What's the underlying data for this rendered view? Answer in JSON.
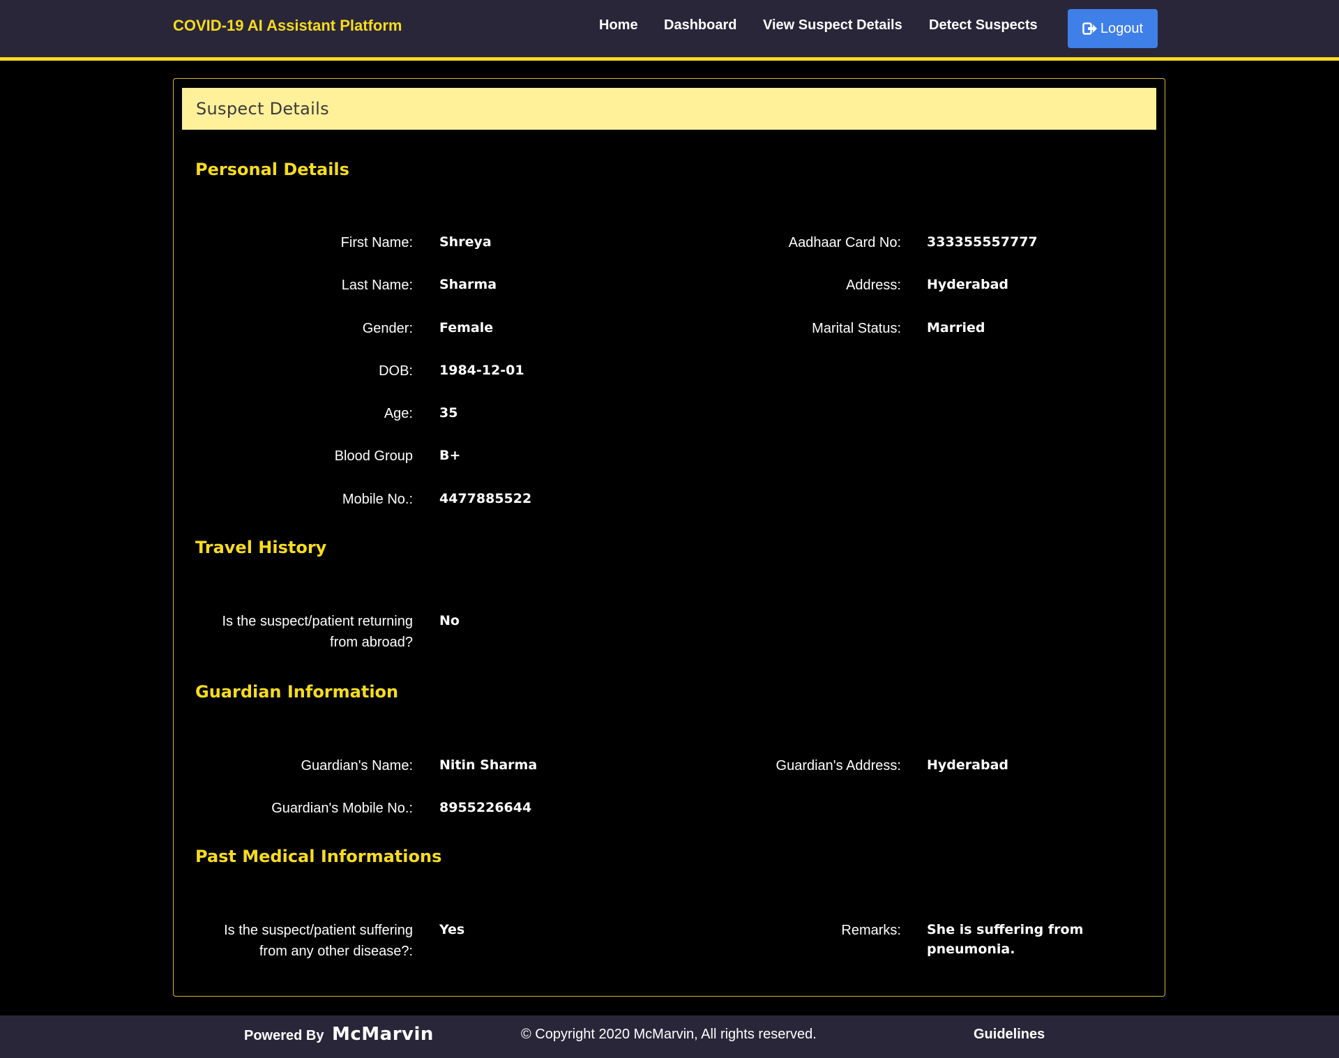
{
  "nav": {
    "brand": "COVID-19 AI Assistant Platform",
    "links": [
      "Home",
      "Dashboard",
      "View Suspect Details",
      "Detect Suspects"
    ],
    "logout": "Logout",
    "logout_icon": "sign-out-icon"
  },
  "card": {
    "header": "Suspect Details",
    "personal": {
      "title": "Personal Details",
      "first_name_label": "First Name:",
      "first_name": "Shreya",
      "last_name_label": "Last Name:",
      "last_name": "Sharma",
      "gender_label": "Gender:",
      "gender": "Female",
      "dob_label": "DOB:",
      "dob": "1984-12-01",
      "age_label": "Age:",
      "age": "35",
      "blood_group_label": "Blood Group",
      "blood_group": "B+",
      "mobile_label": "Mobile No.:",
      "mobile": "4477885522",
      "aadhaar_label": "Aadhaar Card No:",
      "aadhaar": "333355557777",
      "address_label": "Address:",
      "address": "Hyderabad",
      "marital_label": "Marital Status:",
      "marital": "Married"
    },
    "travel": {
      "title": "Travel History",
      "question_line1": "Is the suspect/patient returning",
      "question_line2": "from abroad?",
      "answer": "No"
    },
    "guardian": {
      "title": "Guardian Information",
      "name_label": "Guardian's Name:",
      "name": "Nitin Sharma",
      "mobile_label": "Guardian's Mobile No.:",
      "mobile": "8955226644",
      "address_label": "Guardian's Address:",
      "address": "Hyderabad"
    },
    "medical": {
      "title": "Past Medical Informations",
      "question_line1": "Is the suspect/patient suffering",
      "question_line2": "from any other disease?:",
      "answer": "Yes",
      "remarks_label": "Remarks:",
      "remarks": "She is suffering from pneumonia."
    }
  },
  "footer": {
    "powered_by": "Powered By",
    "logo": "McMarvin",
    "copyright": "© Copyright 2020 McMarvin, All rights reserved.",
    "guidelines": "Guidelines"
  },
  "colors": {
    "navbar_bg": "#2a2639",
    "accent_yellow": "#f7dc1e",
    "card_header_bg": "#fff09a",
    "logout_blue": "#3f7fe8"
  }
}
